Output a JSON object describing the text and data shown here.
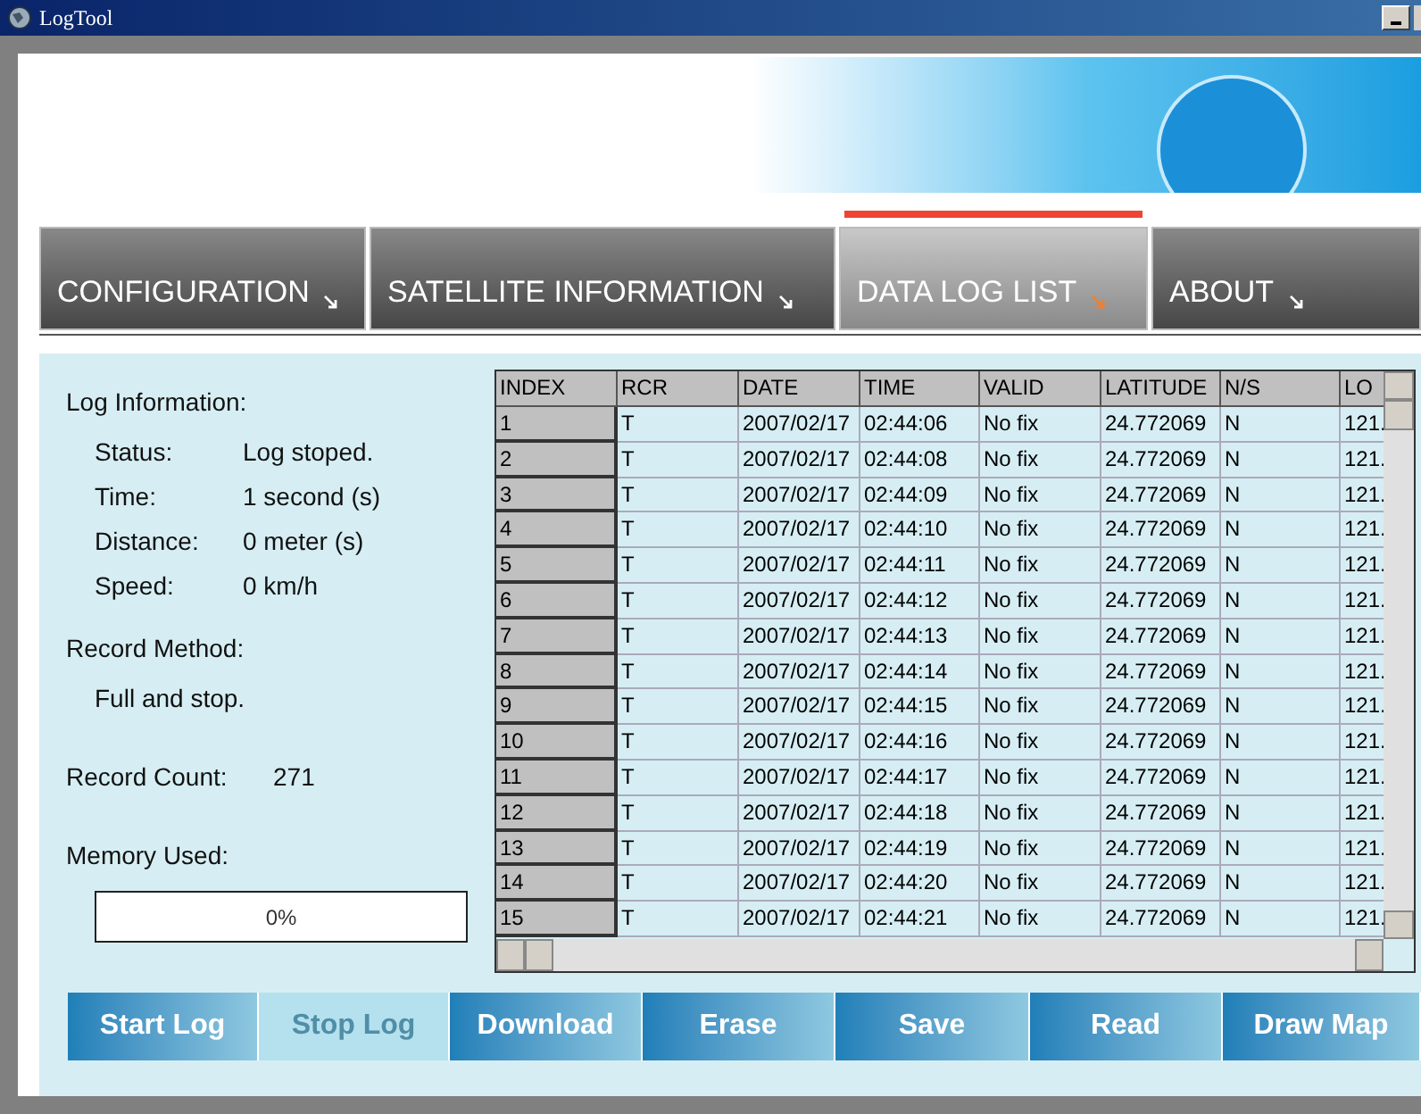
{
  "window": {
    "title": "LogTool"
  },
  "tabs": [
    {
      "label": "CONFIGURATION",
      "selected": false
    },
    {
      "label": "SATELLITE  INFORMATION",
      "selected": false
    },
    {
      "label": "DATA  LOG  LIST",
      "selected": true
    },
    {
      "label": "ABOUT",
      "selected": false
    }
  ],
  "log_information": {
    "heading": "Log Information:",
    "fields": [
      {
        "label": "Status:",
        "value": "Log stoped."
      },
      {
        "label": "Time:",
        "value": "1 second (s)"
      },
      {
        "label": "Distance:",
        "value": "0 meter (s)"
      },
      {
        "label": "Speed:",
        "value": "0 km/h"
      }
    ]
  },
  "record_method": {
    "heading": "Record Method:",
    "value": "Full and stop."
  },
  "record_count": {
    "label": "Record Count:",
    "value": "271"
  },
  "memory_used": {
    "heading": "Memory Used:",
    "level": 0,
    "reading": "0%"
  },
  "table": {
    "columns": [
      "INDEX",
      "RCR",
      "DATE",
      "TIME",
      "VALID",
      "LATITUDE",
      "N/S",
      "LO"
    ],
    "rows": [
      [
        "1",
        "T",
        "2007/02/17",
        "02:44:06",
        "No fix",
        "24.772069",
        "N",
        "121."
      ],
      [
        "2",
        "T",
        "2007/02/17",
        "02:44:08",
        "No fix",
        "24.772069",
        "N",
        "121."
      ],
      [
        "3",
        "T",
        "2007/02/17",
        "02:44:09",
        "No fix",
        "24.772069",
        "N",
        "121."
      ],
      [
        "4",
        "T",
        "2007/02/17",
        "02:44:10",
        "No fix",
        "24.772069",
        "N",
        "121."
      ],
      [
        "5",
        "T",
        "2007/02/17",
        "02:44:11",
        "No fix",
        "24.772069",
        "N",
        "121."
      ],
      [
        "6",
        "T",
        "2007/02/17",
        "02:44:12",
        "No fix",
        "24.772069",
        "N",
        "121."
      ],
      [
        "7",
        "T",
        "2007/02/17",
        "02:44:13",
        "No fix",
        "24.772069",
        "N",
        "121."
      ],
      [
        "8",
        "T",
        "2007/02/17",
        "02:44:14",
        "No fix",
        "24.772069",
        "N",
        "121."
      ],
      [
        "9",
        "T",
        "2007/02/17",
        "02:44:15",
        "No fix",
        "24.772069",
        "N",
        "121."
      ],
      [
        "10",
        "T",
        "2007/02/17",
        "02:44:16",
        "No fix",
        "24.772069",
        "N",
        "121."
      ],
      [
        "11",
        "T",
        "2007/02/17",
        "02:44:17",
        "No fix",
        "24.772069",
        "N",
        "121."
      ],
      [
        "12",
        "T",
        "2007/02/17",
        "02:44:18",
        "No fix",
        "24.772069",
        "N",
        "121."
      ],
      [
        "13",
        "T",
        "2007/02/17",
        "02:44:19",
        "No fix",
        "24.772069",
        "N",
        "121."
      ],
      [
        "14",
        "T",
        "2007/02/17",
        "02:44:20",
        "No fix",
        "24.772069",
        "N",
        "121."
      ],
      [
        "15",
        "T",
        "2007/02/17",
        "02:44:21",
        "No fix",
        "24.772069",
        "N",
        "121."
      ]
    ]
  },
  "buttons": [
    {
      "label": "Start Log",
      "disabled": false
    },
    {
      "label": "Stop Log",
      "disabled": true
    },
    {
      "label": "Download",
      "disabled": false
    },
    {
      "label": "Erase",
      "disabled": false
    },
    {
      "label": "Save",
      "disabled": false
    },
    {
      "label": "Read",
      "disabled": false
    },
    {
      "label": "Draw Map",
      "disabled": false
    }
  ]
}
